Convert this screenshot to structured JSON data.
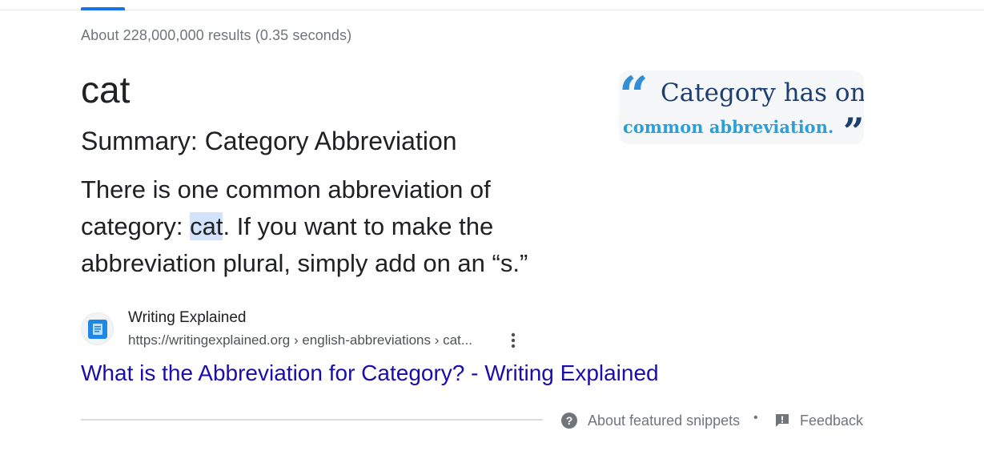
{
  "stats": "About 228,000,000 results (0.35 seconds)",
  "answer": "cat",
  "summary": "Summary: Category Abbreviation",
  "snippet": {
    "before": "There is one common abbreviation of category: ",
    "highlight": "cat",
    "after": ". If you want to make the abbreviation plural, simply add on an “s.”"
  },
  "thumbnail": {
    "open_quote": "“",
    "line1": "Category has one",
    "line2": "common abbreviation.",
    "close_quote": "”"
  },
  "source": {
    "name": "Writing Explained",
    "url": "https://writingexplained.org › english-abbreviations › cat...",
    "icon": "writingexplained-favicon"
  },
  "result_link": "What is the Abbreviation for Category? - Writing Explained",
  "footer": {
    "about_label": "About featured snippets",
    "separator": "•",
    "feedback_label": "Feedback",
    "about_icon": "help-circle-icon",
    "feedback_icon": "feedback-icon"
  },
  "colors": {
    "accent": "#1a73e8",
    "link": "#1a0dab",
    "highlight": "#d3e3fd"
  }
}
